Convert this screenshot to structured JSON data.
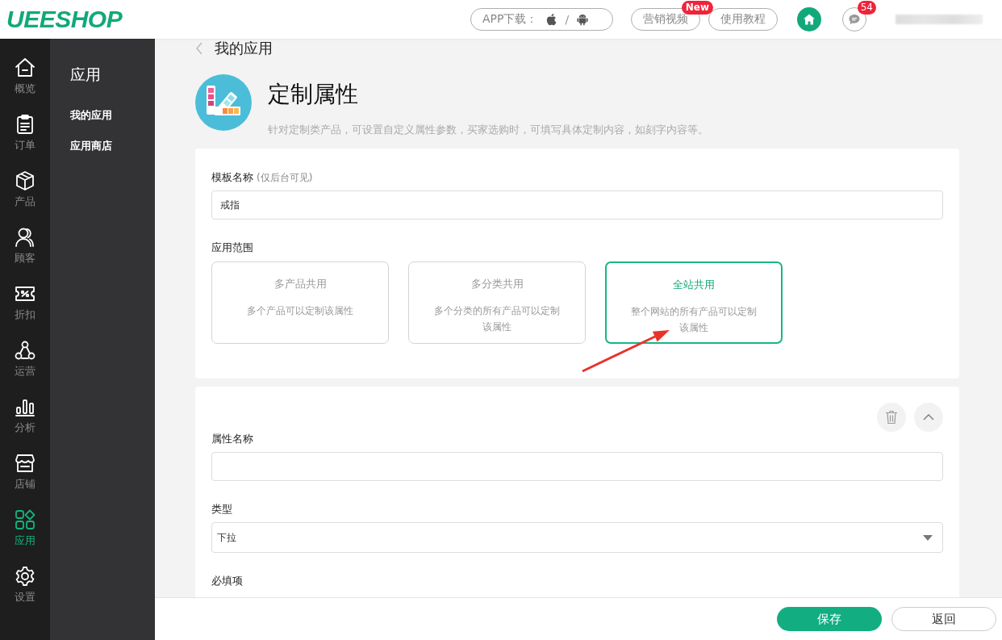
{
  "header": {
    "logo": "UEESHOP",
    "app_download": {
      "label": "APP下载：",
      "separator": "/"
    },
    "links": [
      {
        "label": "营销视频",
        "badge": "New"
      },
      {
        "label": "使用教程"
      }
    ],
    "message_count": "54"
  },
  "nav_rail": [
    {
      "label": "概览",
      "selected": false
    },
    {
      "label": "订单",
      "selected": false
    },
    {
      "label": "产品",
      "selected": false
    },
    {
      "label": "顾客",
      "selected": false
    },
    {
      "label": "折扣",
      "selected": false
    },
    {
      "label": "运营",
      "selected": false
    },
    {
      "label": "分析",
      "selected": false
    },
    {
      "label": "店铺",
      "selected": false
    },
    {
      "label": "应用",
      "selected": true
    },
    {
      "label": "设置",
      "selected": false
    }
  ],
  "sub_sidebar": {
    "title": "应用",
    "items": [
      {
        "label": "我的应用"
      },
      {
        "label": "应用商店"
      }
    ]
  },
  "breadcrumb": "我的应用",
  "app": {
    "title": "定制属性",
    "description": "针对定制类产品，可设置自定义属性参数，买家选购时，可填写具体定制内容，如刻字内容等。"
  },
  "template": {
    "label": "模板名称",
    "hint": "(仅后台可见)",
    "value": "戒指"
  },
  "scope": {
    "label": "应用范围",
    "options": [
      {
        "title": "多产品共用",
        "description": "多个产品可以定制该属性",
        "selected": false
      },
      {
        "title": "多分类共用",
        "description": "多个分类的所有产品可以定制该属性",
        "selected": false
      },
      {
        "title": "全站共用",
        "description": "整个网站的所有产品可以定制该属性",
        "selected": true
      }
    ]
  },
  "attribute": {
    "name_label": "属性名称",
    "type_label": "类型",
    "type_value": "下拉",
    "required_label": "必填项"
  },
  "footer": {
    "buttons": [
      {
        "label": "保存",
        "kind": "primary"
      },
      {
        "label": "返回",
        "kind": "secondary"
      }
    ]
  }
}
